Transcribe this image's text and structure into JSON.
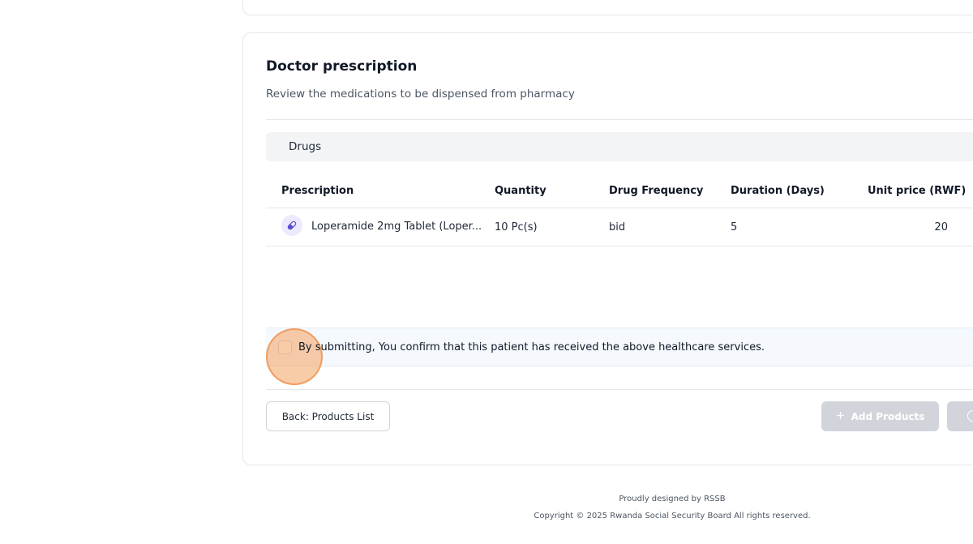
{
  "prescription_card": {
    "title": "Doctor prescription",
    "subtitle": "Review the medications to be dispensed from pharmacy",
    "section_label": "Drugs",
    "table": {
      "headers": [
        "Prescription",
        "Quantity",
        "Drug Frequency",
        "Duration (Days)",
        "Unit price (RWF)"
      ],
      "rows": [
        {
          "icon": "pill-icon",
          "prescription": "Loperamide 2mg Tablet (Loper...",
          "quantity": "10 Pc(s)",
          "frequency": "bid",
          "duration": "5",
          "unit_price": "20"
        }
      ]
    },
    "confirmation": {
      "checked": false,
      "text": "By submitting, You confirm that this patient has received the above healthcare services."
    },
    "buttons": {
      "back_label": "Back: Products List",
      "add_products_label": "Add Products",
      "add_products_icon": "plus-icon",
      "next_icon": "circle-icon"
    }
  },
  "footer": {
    "line1": "Proudly designed by RSSB",
    "line2": "Copyright © 2025 Rwanda Social Security Board All rights reserved."
  },
  "colors": {
    "accent_pill": "#5b4fcf",
    "disabled_button": "#d1d5db",
    "click_indicator": "#f4a261"
  }
}
